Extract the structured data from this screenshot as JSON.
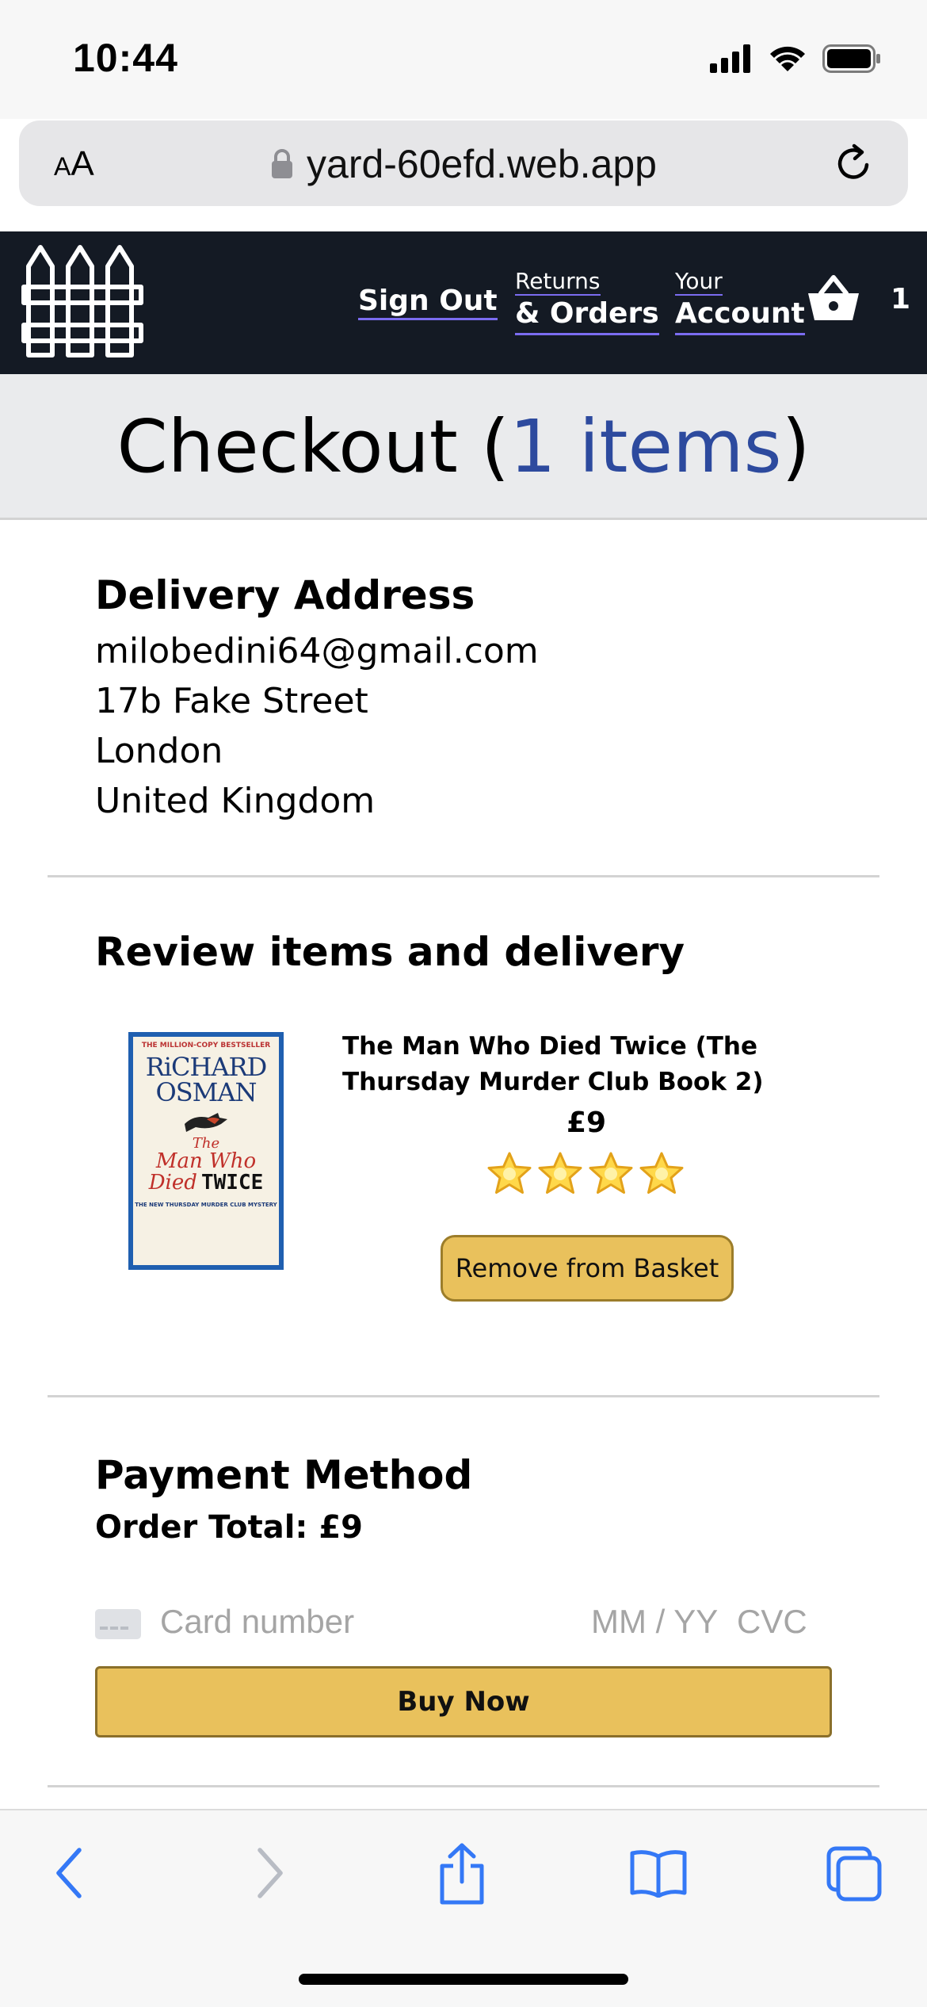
{
  "status_bar": {
    "time": "10:44"
  },
  "browser": {
    "aa_label_small": "A",
    "aa_label_large": "A",
    "url": "yard-60efd.web.app"
  },
  "header": {
    "sign_out": "Sign Out",
    "returns_small": "Returns",
    "returns_big": "& Orders",
    "account_small": "Your",
    "account_big": "Account",
    "basket_count": "1"
  },
  "checkout": {
    "title_prefix": "Checkout (",
    "item_count": "1 items",
    "title_suffix": ")"
  },
  "delivery": {
    "heading": "Delivery Address",
    "lines": [
      "milobedini64@gmail.com",
      "17b Fake Street",
      "London",
      "United Kingdom"
    ]
  },
  "review": {
    "heading": "Review items and delivery",
    "item": {
      "title": "The Man Who Died Twice (The Thursday Murder Club Book 2)",
      "price": "£9",
      "rating": 4,
      "remove_label": "Remove from Basket",
      "cover": {
        "tagline": "THE MILLION-COPY BESTSELLER",
        "author_line1": "RiCHARD",
        "author_line2": "OSMAN",
        "title_the": "The",
        "title_man_who": "Man Who",
        "title_died": "Died",
        "title_twice": "TWICE",
        "series": "THE NEW THURSDAY MURDER CLUB MYSTERY"
      }
    }
  },
  "payment": {
    "heading": "Payment Method",
    "order_total": "Order Total: £9",
    "card_number_placeholder": "Card number",
    "expiry_placeholder": "MM / YY",
    "cvc_placeholder": "CVC",
    "buy_label": "Buy Now"
  },
  "colors": {
    "header_bg": "#141a24",
    "accent_blue": "#2d4a9e",
    "button_gold": "#e9c15c",
    "ios_blue": "#3478f6"
  }
}
